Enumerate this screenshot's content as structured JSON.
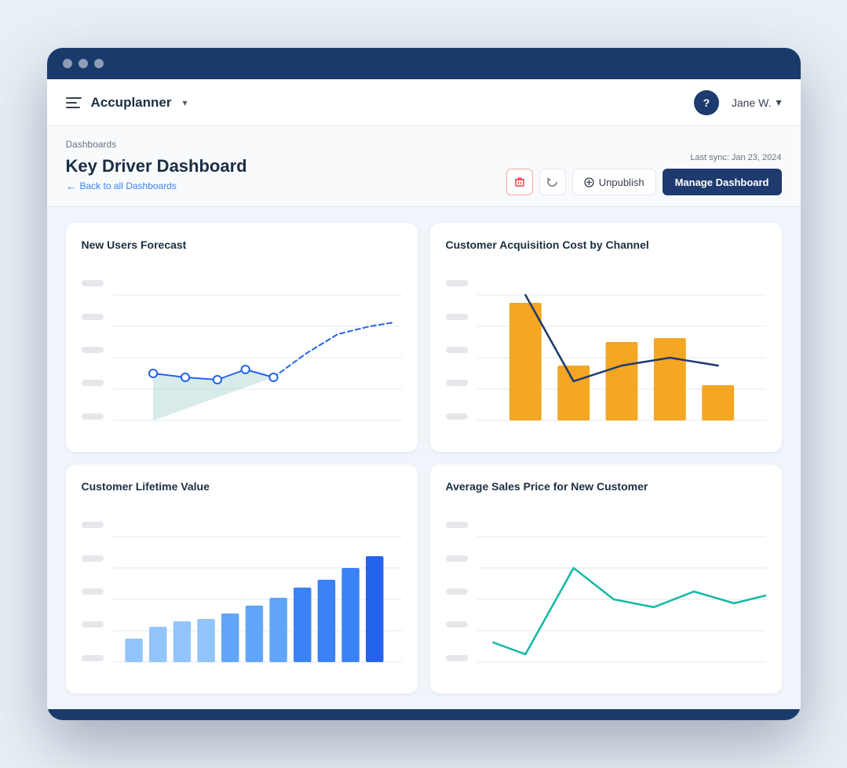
{
  "browser": {
    "dots": [
      "dot1",
      "dot2",
      "dot3"
    ]
  },
  "navbar": {
    "app_name": "Accuplanner",
    "dropdown_label": "▾",
    "help_label": "?",
    "user_name": "Jane W.",
    "user_dropdown": "▾"
  },
  "page_header": {
    "breadcrumb": "Dashboards",
    "title": "Key Driver Dashboard",
    "back_link": "Back to all Dashboards",
    "sync_text": "Last sync: Jan 23, 2024",
    "buttons": {
      "delete_label": "🗑",
      "refresh_label": "↻",
      "unpublish_label": "Unpublish",
      "manage_label": "Manage Dashboard"
    }
  },
  "charts": [
    {
      "id": "chart1",
      "title": "New Users Forecast"
    },
    {
      "id": "chart2",
      "title": "Customer Acquisition Cost by Channel"
    },
    {
      "id": "chart3",
      "title": "Customer Lifetime Value"
    },
    {
      "id": "chart4",
      "title": "Average Sales Price for New Customer"
    }
  ]
}
